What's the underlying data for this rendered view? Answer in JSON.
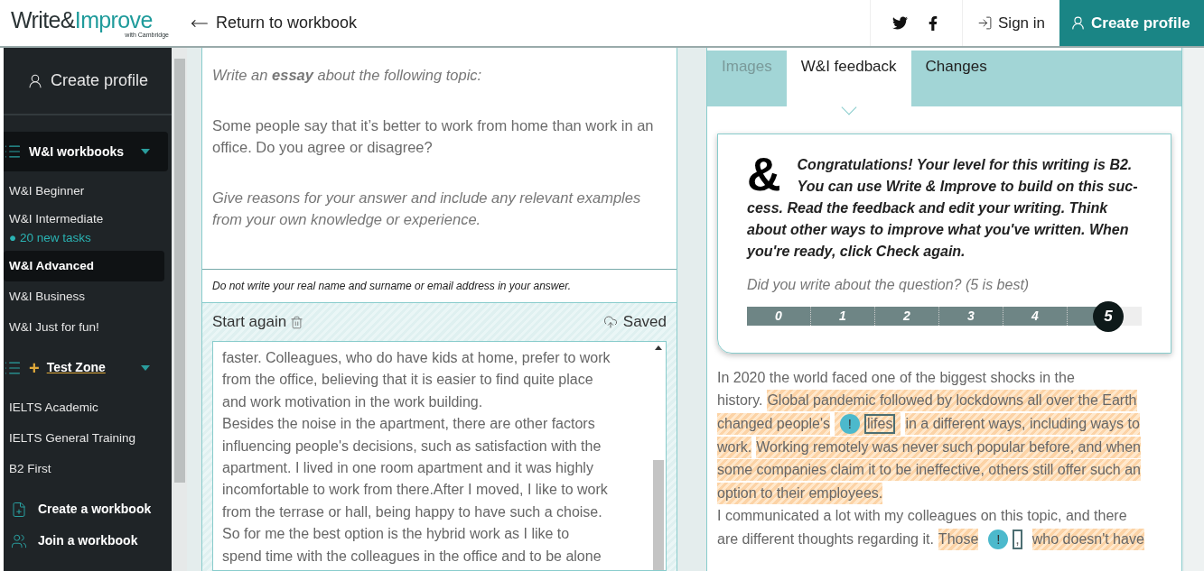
{
  "header": {
    "logo": {
      "first": "Write&",
      "second": "Improve",
      "tagline": "with Cambridge"
    },
    "back_link": "Return to workbook",
    "sign_in": "Sign in",
    "create_profile": "Create profile"
  },
  "sidebar": {
    "create_profile": "Create profile",
    "groups": [
      {
        "title": "W&I workbooks",
        "expanded": true,
        "items": [
          {
            "label": "W&I Beginner",
            "selected": false
          },
          {
            "label": "W&I Intermediate",
            "bullet": "●",
            "note": "20 new tasks",
            "selected": false
          },
          {
            "label": "W&I Advanced",
            "selected": true
          },
          {
            "label": "W&I Business",
            "selected": false
          },
          {
            "label": "W&I Just for fun!",
            "selected": false
          }
        ]
      },
      {
        "title": "Test Zone",
        "prefix": "+",
        "expanded": true,
        "items": [
          {
            "label": "IELTS Academic",
            "selected": false
          },
          {
            "label": "IELTS General Training",
            "selected": false
          },
          {
            "label": "B2 First",
            "selected": false
          }
        ]
      }
    ],
    "actions": [
      {
        "kind": "create",
        "label": "Create a workbook"
      },
      {
        "kind": "join",
        "label": "Join a workbook"
      }
    ]
  },
  "task": {
    "instruction": "Write an **essay** about the following topic:",
    "topic": "Some people say that it’s better to work from home than work in an office. Do you agree or disagree?",
    "guidance": "Give reasons for your answer and include any relevant examples from your own knowledge or experience.",
    "notice": "Do not write your real name and surname or email address in your answer."
  },
  "editor": {
    "start_again": "Start again",
    "status": "Saved",
    "lines": [
      "faster. Colleagues, who do have kids at home, prefer to work",
      "from the office, believing that it is easier to find quite place",
      "and work motivation in the work building.",
      "Besides the noise in the apartment, there are other factors",
      "influencing people's decisions, such as satisfaction with the",
      "apartment. I lived in one room apartment and it was highly",
      "incomfortable to work from there.After I moved, I like to work",
      "from the terrase or hall, being happy to have such a choise.",
      "So for me the best option is the hybrid work as I like to",
      "spend time with the colleagues in the office and to be alone"
    ]
  },
  "feedback": {
    "tabs": [
      {
        "label": "Images",
        "selected": false,
        "disabled": true
      },
      {
        "label": "W&I feedback",
        "selected": true,
        "disabled": false
      },
      {
        "label": "Changes",
        "selected": false,
        "disabled": false
      }
    ],
    "logo_glyph": "&",
    "message_lines": [
      "Congratulations! Your level for this writing is B2.",
      "You can use Write & Improve to build on this suc-",
      "cess. Read the feedback and edit your writing. Think",
      "about other ways to improve what you've written. When",
      "you're ready, click Check again."
    ],
    "question": "Did you write about the question? (5 is best)",
    "scale": [
      {
        "label": "0",
        "selected": false
      },
      {
        "label": "1",
        "selected": false
      },
      {
        "label": "2",
        "selected": false
      },
      {
        "label": "3",
        "selected": false
      },
      {
        "label": "4",
        "selected": false
      },
      {
        "label": "5",
        "selected": true
      }
    ],
    "lines": [
      [
        {
          "kind": "text",
          "text": "In 2020 the world faced one of the biggest shocks in the",
          "highlighted": false
        }
      ],
      [
        {
          "kind": "text",
          "text": "history.",
          "highlighted": false
        },
        {
          "kind": "text",
          "text": "Global pandemic followed by lockdowns all over the Earth",
          "highlighted": true
        }
      ],
      [
        {
          "kind": "text",
          "text": "changed people's",
          "highlighted": true
        },
        {
          "kind": "error",
          "marker": "!",
          "text": "lifes",
          "highlighted": true
        },
        {
          "kind": "text",
          "text": "in a different ways, including ways to",
          "highlighted": true
        }
      ],
      [
        {
          "kind": "text",
          "text": "work.",
          "highlighted": true
        },
        {
          "kind": "text",
          "text": "Working remotely was never such popular before, and when",
          "highlighted": true
        }
      ],
      [
        {
          "kind": "text",
          "text": "some companies claim it to be ineffective, others still offer such an",
          "highlighted": true
        }
      ],
      [
        {
          "kind": "text",
          "text": "option to their employees.",
          "highlighted": true
        }
      ],
      [
        {
          "kind": "text",
          "text": "I communicated a lot with my colleagues on this topic, and there",
          "highlighted": false
        }
      ],
      [
        {
          "kind": "text",
          "text": "are different thoughts regarding it.",
          "highlighted": false
        },
        {
          "kind": "text",
          "text": "Those",
          "highlighted": true
        },
        {
          "kind": "error",
          "marker": "!",
          "text": ",",
          "highlighted": false
        },
        {
          "kind": "text",
          "text": "who doesn't have",
          "highlighted": true
        }
      ]
    ]
  }
}
